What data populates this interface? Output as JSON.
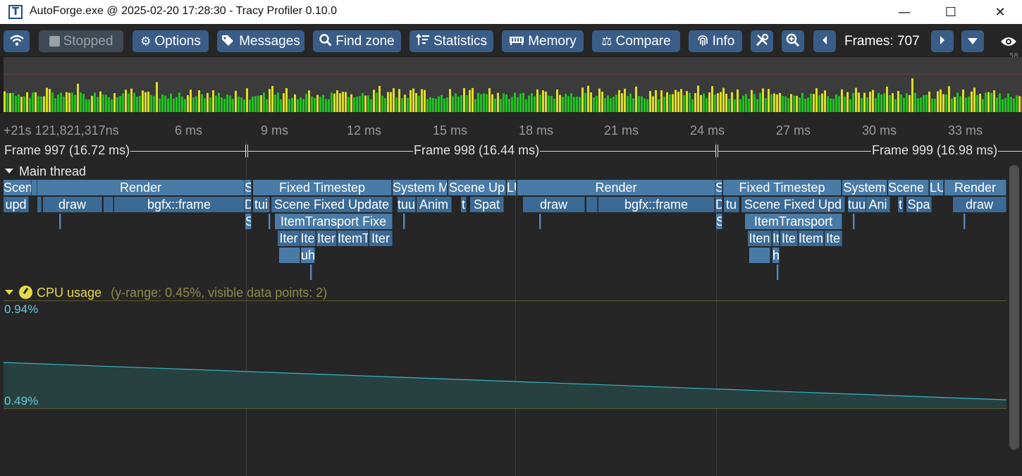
{
  "window": {
    "title": "AutoForge.exe @ 2025-02-20 17:28:30 - Tracy Profiler 0.10.0",
    "minimize": "—",
    "maximize": "☐",
    "close": "✕"
  },
  "toolbar": {
    "connection_icon": "wifi-icon",
    "stopped": "Stopped",
    "options": "Options",
    "messages": "Messages",
    "find_zone": "Find zone",
    "statistics": "Statistics",
    "memory": "Memory",
    "compare": "Compare",
    "info": "Info",
    "frames_label": "Frames: 707",
    "fps_small": "58",
    "icons": [
      "wifi-icon",
      "stop-icon",
      "gear-icon",
      "tags-icon",
      "search-icon",
      "sort-icon",
      "memory-icon",
      "scale-icon",
      "fingerprint-icon",
      "tools-icon",
      "zoom-icon",
      "caret-left-icon",
      "caret-right-icon",
      "caret-down-icon",
      "eye-icon"
    ]
  },
  "colors": {
    "accent_button": "#3a5d88",
    "zone": "#4a7aa6",
    "frame_bar_good": "#1fc21f",
    "frame_bar_slow": "#dede22",
    "cpu_line": "#36b5c5",
    "cpu_header": "#e5d84a",
    "cpu_info": "#8d8a4a"
  },
  "timeline": {
    "ticks": [
      "+21s 121,821,317ns",
      "6 ms",
      "9 ms",
      "12 ms",
      "15 ms",
      "18 ms",
      "21 ms",
      "24 ms",
      "27 ms",
      "30 ms",
      "33 ms"
    ],
    "frames": [
      "Frame 997 (16.72 ms)",
      "Frame 998 (16.44 ms)",
      "Frame 999 (16.98 ms)"
    ],
    "main_thread": "Main thread",
    "zones_row1": [
      "Scen",
      "Render",
      "S",
      "Fixed Timestep",
      "System M",
      "Scene Up",
      "LU",
      "Render",
      "S",
      "Fixed Timestep",
      "System",
      "Scene U",
      "LU",
      "Render"
    ],
    "zones_row2": [
      "upd",
      "draw",
      "bgfx::frame",
      "D",
      "tui",
      "Scene Fixed Update",
      "tuu",
      "Anim",
      "t",
      "Spat",
      "draw",
      "bgfx::frame",
      "D",
      "tu",
      "Scene Fixed Upd",
      "tuu",
      "Ani",
      "t",
      "Spa",
      "draw"
    ],
    "zones_row3": [
      "S",
      "ItemTransport Fixe",
      "S",
      "ItemTransport"
    ],
    "zones_row4": [
      "Iter",
      "Ite",
      "Iter",
      "ItemT",
      "Iter",
      "Iten",
      "It",
      "Ite",
      "Item",
      "Ite"
    ],
    "zones_row5": [
      "uh",
      "h"
    ]
  },
  "cpu_usage": {
    "title": "CPU usage",
    "info": "(y-range: 0.45%, visible data points: 2)",
    "max_label": "0.94%",
    "min_label": "0.49%",
    "icon": "dashboard-icon"
  }
}
